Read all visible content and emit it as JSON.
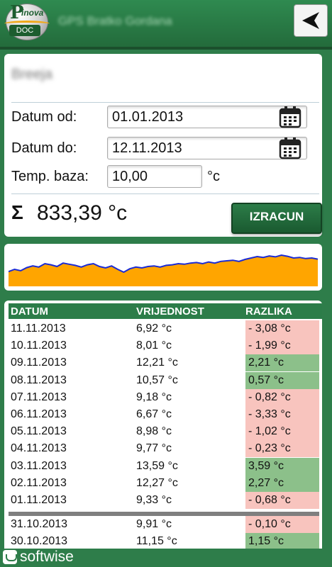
{
  "header": {
    "app_title": "GPS Bratko Gordana",
    "logo": {
      "line1": "P",
      "line2": "inova",
      "line3": "DOC"
    },
    "back_icon": "back-arrow-icon"
  },
  "form": {
    "station": "Breeja",
    "date_from_label": "Datum od:",
    "date_from_value": "01.01.2013",
    "date_to_label": "Datum do:",
    "date_to_value": "12.11.2013",
    "temp_base_label": "Temp. baza:",
    "temp_base_value": "10,00",
    "temp_unit": "°c",
    "sigma": "Σ",
    "total": "833,39 °c",
    "calc_button": "IZRACUN",
    "calendar_icon": "calendar-icon"
  },
  "chart": {
    "fill_color": "#ffa500",
    "line_color": "#1a2bd6",
    "values": [
      0.42,
      0.5,
      0.45,
      0.56,
      0.62,
      0.58,
      0.7,
      0.66,
      0.6,
      0.72,
      0.68,
      0.64,
      0.58,
      0.66,
      0.7,
      0.6,
      0.55,
      0.62,
      0.5,
      0.4,
      0.52,
      0.58,
      0.55,
      0.6,
      0.62,
      0.58,
      0.64,
      0.66,
      0.7,
      0.68,
      0.72,
      0.74,
      0.7,
      0.76,
      0.72,
      0.78,
      0.8,
      0.82,
      0.78,
      0.85,
      0.9,
      0.95,
      0.92,
      0.97,
      0.94,
      1.0,
      0.96,
      0.9,
      0.92,
      0.88,
      0.9,
      0.86
    ]
  },
  "table": {
    "headers": [
      "DATUM",
      "VRIJEDNOST",
      "RAZLIKA"
    ],
    "rows": [
      {
        "date": "11.11.2013",
        "value": "6,92 °c",
        "diff": "- 3,08 °c",
        "sign": "neg"
      },
      {
        "date": "10.11.2013",
        "value": "8,01 °c",
        "diff": "- 1,99 °c",
        "sign": "neg"
      },
      {
        "date": "09.11.2013",
        "value": "12,21 °c",
        "diff": "2,21 °c",
        "sign": "pos"
      },
      {
        "date": "08.11.2013",
        "value": "10,57 °c",
        "diff": "0,57 °c",
        "sign": "pos"
      },
      {
        "date": "07.11.2013",
        "value": "9,18 °c",
        "diff": "- 0,82 °c",
        "sign": "neg"
      },
      {
        "date": "06.11.2013",
        "value": "6,67 °c",
        "diff": "- 3,33 °c",
        "sign": "neg"
      },
      {
        "date": "05.11.2013",
        "value": "8,98 °c",
        "diff": "- 1,02 °c",
        "sign": "neg"
      },
      {
        "date": "04.11.2013",
        "value": "9,77 °c",
        "diff": "- 0,23 °c",
        "sign": "neg"
      },
      {
        "date": "03.11.2013",
        "value": "13,59 °c",
        "diff": "3,59 °c",
        "sign": "pos"
      },
      {
        "date": "02.11.2013",
        "value": "12,27 °c",
        "diff": "2,27 °c",
        "sign": "pos"
      },
      {
        "date": "01.11.2013",
        "value": "9,33 °c",
        "diff": "- 0,68 °c",
        "sign": "neg"
      },
      {
        "date": "31.10.2013",
        "value": "9,91 °c",
        "diff": "- 0,10 °c",
        "sign": "neg"
      },
      {
        "date": "30.10.2013",
        "value": "11,15 °c",
        "diff": "1,15 °c",
        "sign": "pos"
      }
    ]
  },
  "footer": {
    "brand": "softwise"
  }
}
